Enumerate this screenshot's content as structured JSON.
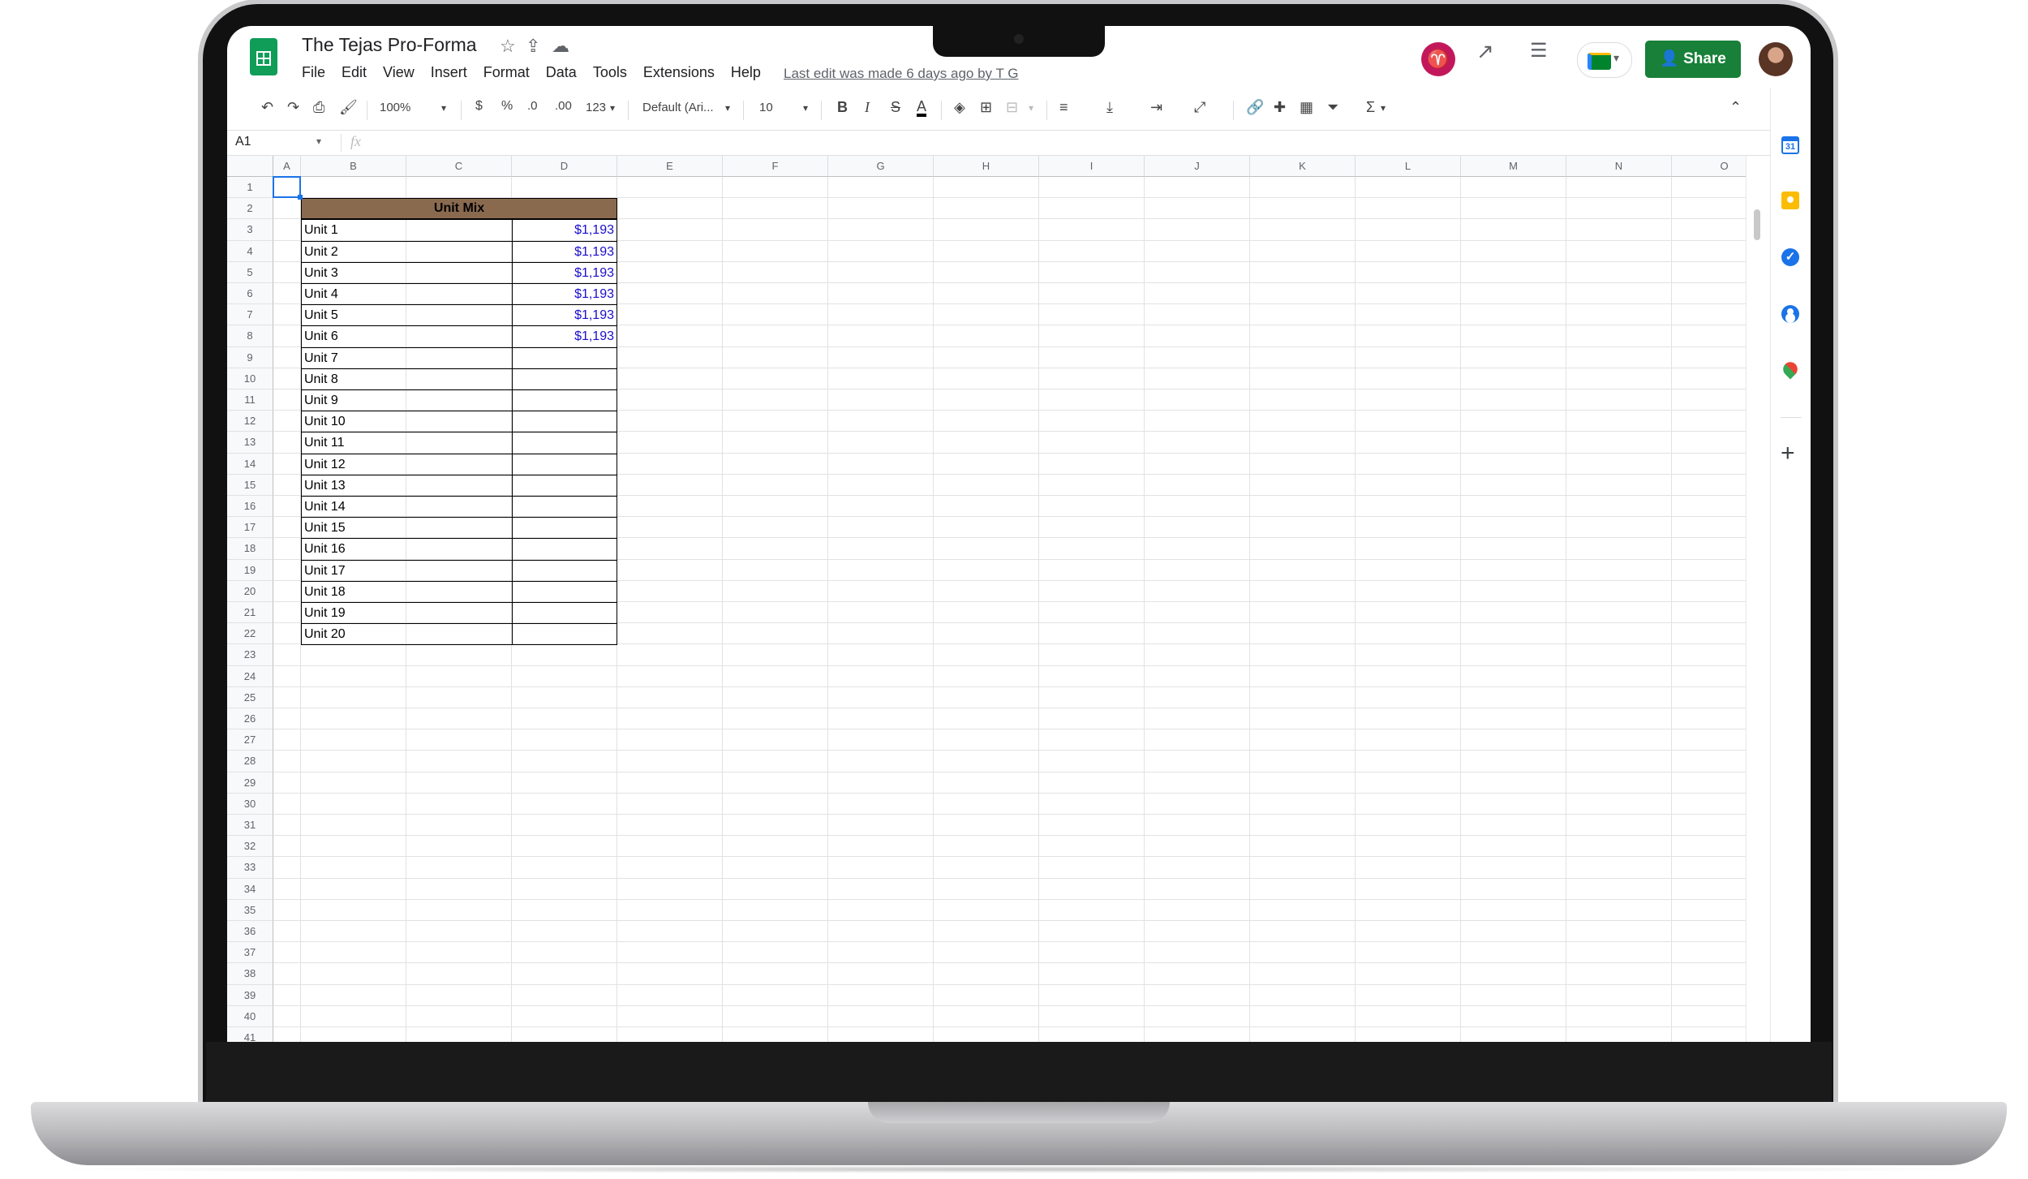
{
  "document": {
    "title": "The Tejas Pro-Forma",
    "last_edit": "Last edit was made 6 days ago by T G"
  },
  "menu": [
    "File",
    "Edit",
    "View",
    "Insert",
    "Format",
    "Data",
    "Tools",
    "Extensions",
    "Help"
  ],
  "header_actions": {
    "share_label": "Share"
  },
  "toolbar": {
    "zoom": "100%",
    "currency": "$",
    "percent": "%",
    "decrease_decimal": ".0",
    "increase_decimal": ".00",
    "number_format": "123",
    "font": "Default (Ari...",
    "font_size": "10",
    "bold": "B",
    "italic": "I",
    "strikethrough": "S",
    "text_color": "A",
    "sum": "Σ"
  },
  "formula_bar": {
    "name_box": "A1",
    "fx": "fx"
  },
  "sheet": {
    "columns": [
      "A",
      "B",
      "C",
      "D",
      "E",
      "F",
      "G",
      "H",
      "I",
      "J",
      "K",
      "L",
      "M",
      "N",
      "O"
    ],
    "rows": [
      "1",
      "2",
      "3",
      "4",
      "5",
      "6",
      "7",
      "8",
      "9",
      "10",
      "11",
      "12",
      "13",
      "14",
      "15",
      "16",
      "17",
      "18",
      "19",
      "20",
      "21",
      "22",
      "23",
      "24",
      "25",
      "26",
      "27",
      "28",
      "29",
      "30",
      "31",
      "32",
      "33",
      "34",
      "35",
      "36",
      "37",
      "38",
      "39",
      "40",
      "41"
    ],
    "selected_cell": "A1",
    "table_header": "Unit Mix",
    "units": [
      {
        "name": "Unit 1",
        "value": "$1,193"
      },
      {
        "name": "Unit 2",
        "value": "$1,193"
      },
      {
        "name": "Unit 3",
        "value": "$1,193"
      },
      {
        "name": "Unit 4",
        "value": "$1,193"
      },
      {
        "name": "Unit 5",
        "value": "$1,193"
      },
      {
        "name": "Unit 6",
        "value": "$1,193"
      },
      {
        "name": "Unit 7",
        "value": ""
      },
      {
        "name": "Unit 8",
        "value": ""
      },
      {
        "name": "Unit 9",
        "value": ""
      },
      {
        "name": "Unit 10",
        "value": ""
      },
      {
        "name": "Unit 11",
        "value": ""
      },
      {
        "name": "Unit 12",
        "value": ""
      },
      {
        "name": "Unit 13",
        "value": ""
      },
      {
        "name": "Unit 14",
        "value": ""
      },
      {
        "name": "Unit 15",
        "value": ""
      },
      {
        "name": "Unit 16",
        "value": ""
      },
      {
        "name": "Unit 17",
        "value": ""
      },
      {
        "name": "Unit 18",
        "value": ""
      },
      {
        "name": "Unit 19",
        "value": ""
      },
      {
        "name": "Unit 20",
        "value": ""
      }
    ]
  },
  "side_panel": {
    "calendar_day": "31",
    "tasks_glyph": "✓",
    "add_glyph": "+"
  },
  "colors": {
    "share_button": "#188038",
    "header_fill": "#8a6a4f",
    "value_text": "#1a0dcc",
    "selection": "#1a73e8"
  }
}
